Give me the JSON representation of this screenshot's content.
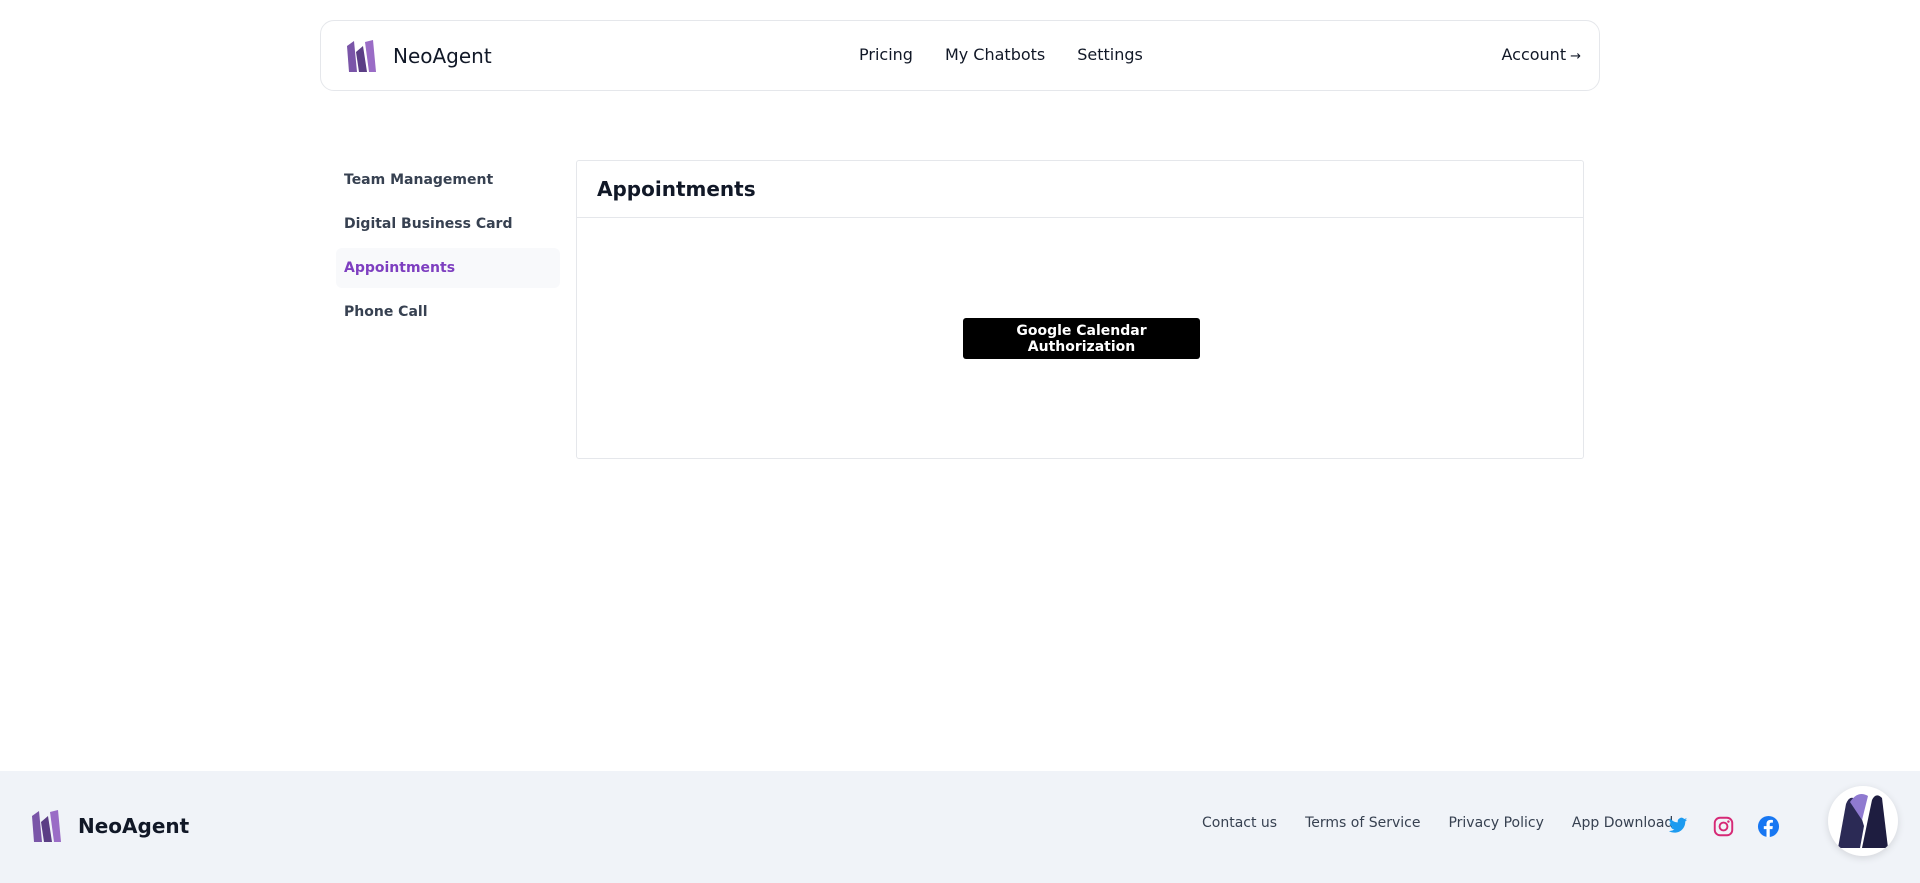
{
  "header": {
    "brand": "NeoAgent",
    "nav": [
      "Pricing",
      "My Chatbots",
      "Settings"
    ],
    "account": "Account",
    "account_arrow": "→"
  },
  "sidebar": {
    "items": [
      {
        "label": "Team Management"
      },
      {
        "label": "Digital Business Card"
      },
      {
        "label": "Appointments",
        "active": true
      },
      {
        "label": "Phone Call"
      }
    ]
  },
  "main": {
    "title": "Appointments",
    "button": "Google Calendar Authorization"
  },
  "footer": {
    "brand": "NeoAgent",
    "links": [
      "Contact us",
      "Terms of Service",
      "Privacy Policy",
      "App Download"
    ],
    "socials": [
      "twitter-icon",
      "instagram-icon",
      "facebook-icon"
    ]
  },
  "colors": {
    "accent": "#7e3fc0",
    "twitter": "#1d9bf0",
    "instagram": "#d62976",
    "facebook": "#1877f2",
    "footer_bg": "#f0f3f8"
  }
}
